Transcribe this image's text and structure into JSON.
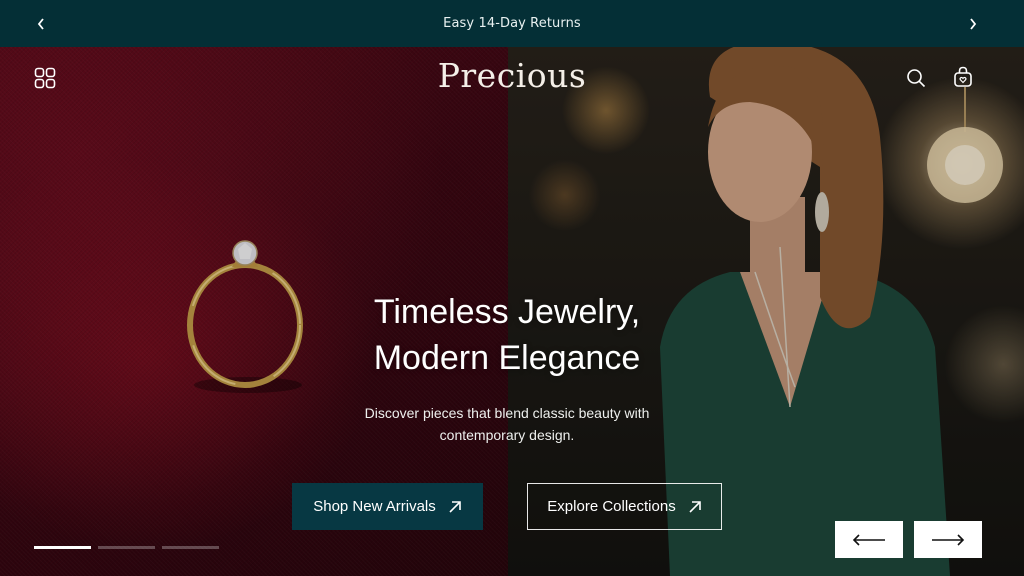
{
  "announcement": {
    "text": "Easy 14-Day Returns",
    "prev_icon": "chevron-left-icon",
    "next_icon": "chevron-right-icon"
  },
  "header": {
    "logo": "Precious",
    "menu_icon": "grid-menu-icon",
    "search_icon": "search-icon",
    "bag_icon": "shopping-bag-icon"
  },
  "hero": {
    "headline_line1": "Timeless Jewelry,",
    "headline_line2": "Modern Elegance",
    "subtext_line1": "Discover pieces that blend classic beauty with",
    "subtext_line2": "contemporary design.",
    "primary_button": "Shop New Arrivals",
    "secondary_button": "Explore Collections",
    "button_icon": "arrow-up-right-icon"
  },
  "slider": {
    "slides": 3,
    "active_index": 0,
    "prev_icon": "arrow-left-icon",
    "next_icon": "arrow-right-icon"
  },
  "colors": {
    "announcement_bg": "#042f36",
    "primary_button_bg": "#073843",
    "velvet": "#5a0b1a",
    "dress": "#1f4a3c"
  }
}
